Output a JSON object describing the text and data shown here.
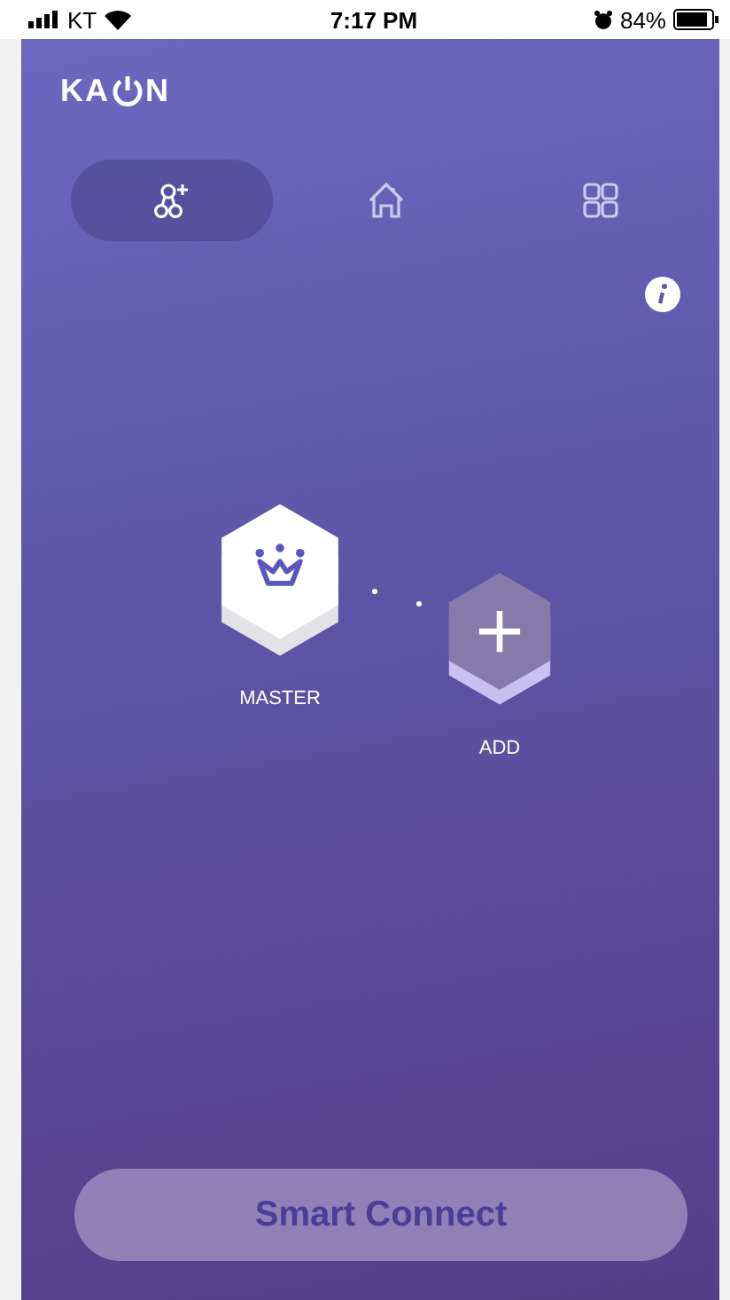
{
  "status_bar": {
    "carrier": "KT",
    "time": "7:17 PM",
    "battery": "84%"
  },
  "logo": {
    "left": "KA",
    "right": "N"
  },
  "tabs": [
    {
      "kind": "network",
      "selected": true
    },
    {
      "kind": "home",
      "selected": false
    },
    {
      "kind": "grid",
      "selected": false
    }
  ],
  "nodes": [
    {
      "kind": "master",
      "label": "MASTER"
    },
    {
      "kind": "add",
      "label": "ADD"
    }
  ],
  "button": {
    "label": "Smart Connect",
    "disabled": true
  }
}
